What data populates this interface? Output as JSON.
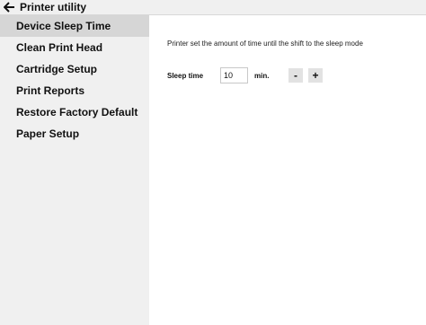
{
  "window": {
    "title": "Printer utility",
    "back_icon": "arrow-left-icon"
  },
  "sidebar": {
    "items": [
      {
        "label": "Device Sleep Time",
        "active": true
      },
      {
        "label": "Clean Print Head",
        "active": false
      },
      {
        "label": "Cartridge Setup",
        "active": false
      },
      {
        "label": "Print Reports",
        "active": false
      },
      {
        "label": "Restore Factory Default",
        "active": false
      },
      {
        "label": "Paper Setup",
        "active": false
      }
    ]
  },
  "main": {
    "description": "Printer set the amount of time until the shift to the sleep mode",
    "sleep_time": {
      "label": "Sleep time",
      "value": "10",
      "unit": "min.",
      "decrement_label": "-",
      "increment_label": "+"
    }
  },
  "colors": {
    "sidebar_bg": "#f0f0f0",
    "active_item_bg": "#d6d6d6",
    "button_bg": "#e2e2e2"
  }
}
